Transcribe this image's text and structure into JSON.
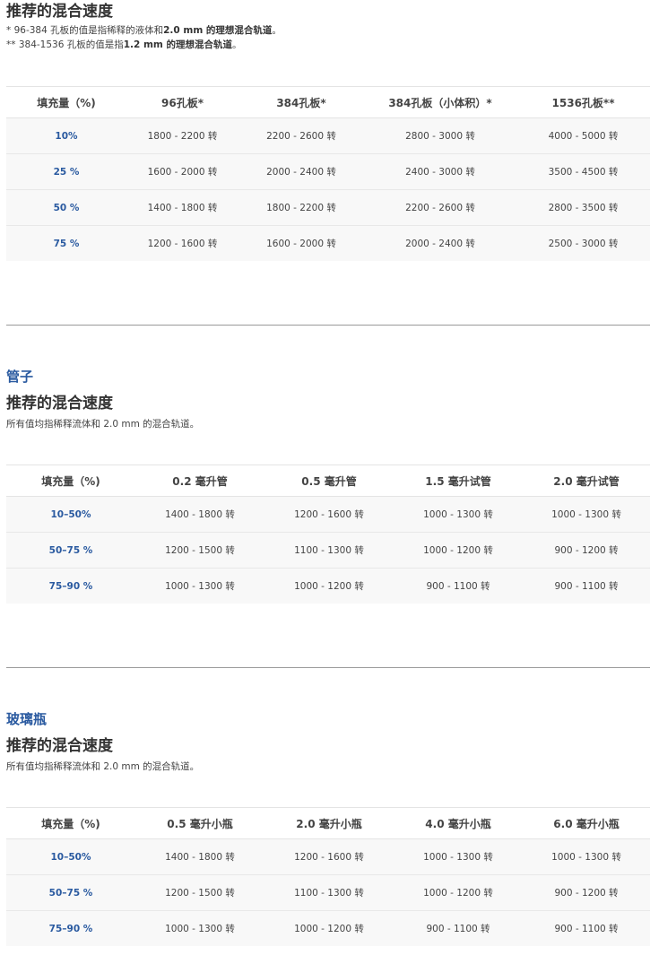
{
  "plates": {
    "heading": "推荐的混合速度",
    "note1_parts": [
      "* 96-384 孔板的值是指稀释的液体和",
      "2.0 mm 的理想混合轨道",
      "。"
    ],
    "note2_parts": [
      "** 384-1536 孔板的值是指",
      "1.2 mm 的理想混合轨道",
      "。"
    ],
    "headers": [
      "填充量（%)",
      "96孔板*",
      "384孔板*",
      "384孔板（小体积）*",
      "1536孔板**"
    ],
    "rows": [
      [
        "10%",
        "1800 - 2200 转",
        "2200 - 2600 转",
        "2800 - 3000 转",
        "4000 - 5000 转"
      ],
      [
        "25 %",
        "1600 - 2000 转",
        "2000 - 2400 转",
        "2400 - 3000 转",
        "3500 - 4500 转"
      ],
      [
        "50 %",
        "1400 - 1800 转",
        "1800 - 2200 转",
        "2200 - 2600 转",
        "2800 - 3500 转"
      ],
      [
        "75 %",
        "1200 - 1600 转",
        "1600 - 2000 转",
        "2000 - 2400 转",
        "2500 - 3000 转"
      ]
    ]
  },
  "tubes": {
    "section_title": "管子",
    "heading": "推荐的混合速度",
    "note": "所有值均指稀释流体和 2.0 mm 的混合轨道。",
    "headers": [
      "填充量（%)",
      "0.2 毫升管",
      "0.5 毫升管",
      "1.5 毫升试管",
      "2.0 毫升试管"
    ],
    "rows": [
      [
        "10–50%",
        "1400 - 1800 转",
        "1200 - 1600 转",
        "1000 - 1300 转",
        "1000 - 1300 转"
      ],
      [
        "50–75 %",
        "1200 - 1500 转",
        "1100 - 1300 转",
        "1000 - 1200 转",
        "900 - 1200 转"
      ],
      [
        "75–90 %",
        "1000 - 1300 转",
        "1000 - 1200 转",
        "900 - 1100 转",
        "900 - 1100 转"
      ]
    ]
  },
  "vials": {
    "section_title": "玻璃瓶",
    "heading": "推荐的混合速度",
    "note": "所有值均指稀释流体和 2.0 mm 的混合轨道。",
    "headers": [
      "填充量（%)",
      "0.5 毫升小瓶",
      "2.0 毫升小瓶",
      "4.0 毫升小瓶",
      "6.0 毫升小瓶"
    ],
    "rows": [
      [
        "10–50%",
        "1400 - 1800 转",
        "1200 - 1600 转",
        "1000 - 1300 转",
        "1000 - 1300 转"
      ],
      [
        "50–75 %",
        "1200 - 1500 转",
        "1100 - 1300 转",
        "1000 - 1200 转",
        "900 - 1200 转"
      ],
      [
        "75–90 %",
        "1000 - 1300 转",
        "1000 - 1200 转",
        "900 - 1100 转",
        "900 - 1100 转"
      ]
    ]
  }
}
